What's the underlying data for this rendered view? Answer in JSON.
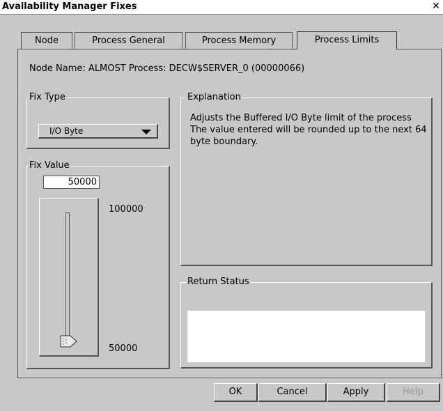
{
  "window": {
    "title": "Availability Manager Fixes"
  },
  "tabs": [
    {
      "label": "Node"
    },
    {
      "label": "Process General"
    },
    {
      "label": "Process Memory"
    },
    {
      "label": "Process Limits",
      "active": true
    }
  ],
  "info": {
    "line": "Node Name: ALMOST  Process: DECW$SERVER_0 (00000066)"
  },
  "fix_type": {
    "legend": "Fix Type",
    "selected": "I/O Byte"
  },
  "fix_value": {
    "legend": "Fix Value",
    "value": "50000",
    "max_label": "100000",
    "min_label": "50000",
    "slider_fraction": 0.0
  },
  "explanation": {
    "legend": "Explanation",
    "line1": "Adjusts the Buffered I/O Byte limit of the process",
    "line2": "The value entered will be rounded up to the next 64 byte boundary."
  },
  "return_status": {
    "legend": "Return Status",
    "text": ""
  },
  "buttons": {
    "ok": "OK",
    "cancel": "Cancel",
    "apply": "Apply",
    "help": "Help"
  },
  "colors": {
    "background": "#c8c8c8",
    "field": "#ffffff",
    "disabled_text": "#999999"
  }
}
